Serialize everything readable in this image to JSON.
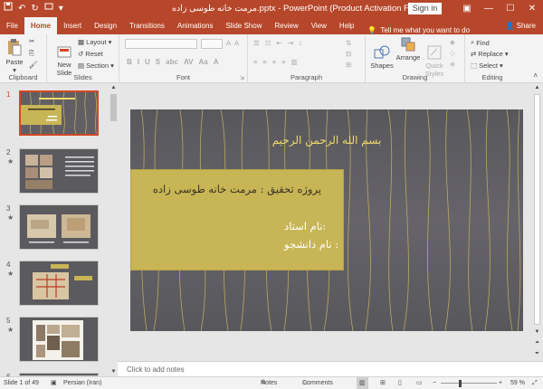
{
  "titlebar": {
    "title": "مرمت خانه طوسی زاده.pptx - PowerPoint (Product Activation Failed)",
    "sign_in": "Sign in"
  },
  "tabs": [
    "File",
    "Home",
    "Insert",
    "Design",
    "Transitions",
    "Animations",
    "Slide Show",
    "Review",
    "View",
    "Help"
  ],
  "tell_me": "Tell me what you want to do",
  "share": "Share",
  "ribbon": {
    "clipboard": {
      "paste": "Paste",
      "label": "Clipboard"
    },
    "slides": {
      "new_slide": "New\nSlide",
      "layout": "Layout",
      "reset": "Reset",
      "section": "Section",
      "label": "Slides"
    },
    "font": {
      "label": "Font",
      "buttons": [
        "B",
        "I",
        "U",
        "S",
        "abc",
        "AV",
        "Aa",
        "A"
      ]
    },
    "paragraph": {
      "label": "Paragraph"
    },
    "drawing": {
      "shapes": "Shapes",
      "arrange": "Arrange",
      "quick_styles": "Quick\nStyles",
      "label": "Drawing"
    },
    "editing": {
      "find": "Find",
      "replace": "Replace",
      "select": "Select",
      "label": "Editing"
    }
  },
  "thumbnails": [
    {
      "num": "1",
      "selected": true
    },
    {
      "num": "2",
      "star": "★"
    },
    {
      "num": "3",
      "star": "★"
    },
    {
      "num": "4",
      "star": "★"
    },
    {
      "num": "5",
      "star": "★"
    },
    {
      "num": "6"
    }
  ],
  "slide": {
    "title": "بسم الله الرحمن الرحیم",
    "project": "پروژه تحقیق : مرمت خانه طوسی زاده",
    "teacher": "نام استاد:",
    "student": "نام دانشجو :"
  },
  "notes_placeholder": "Click to add notes",
  "status": {
    "slide_of": "Slide 1 of 49",
    "language": "Persian (Iran)",
    "notes": "Notes",
    "comments": "Comments",
    "zoom": "59 %"
  }
}
